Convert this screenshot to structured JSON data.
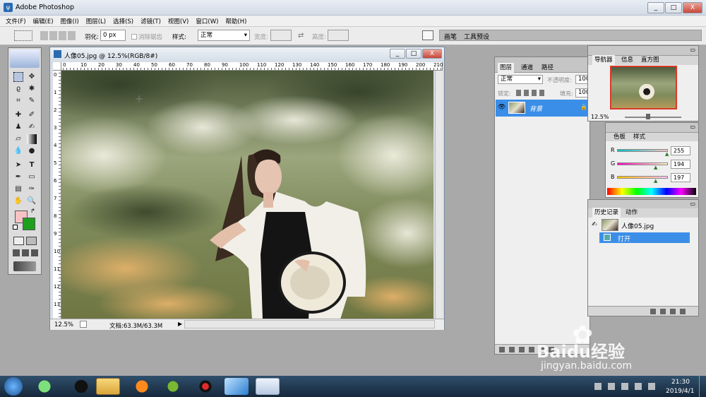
{
  "app": {
    "title": "Adobe Photoshop",
    "controls": {
      "minimize": "_",
      "maximize": "□",
      "close": "X"
    }
  },
  "menu": [
    "文件(F)",
    "编辑(E)",
    "图像(I)",
    "图层(L)",
    "选择(S)",
    "滤镜(T)",
    "视图(V)",
    "窗口(W)",
    "帮助(H)"
  ],
  "options": {
    "feather_label": "羽化:",
    "feather_value": "0 px",
    "antialias_label": "消除锯齿",
    "style_label": "样式:",
    "style_value": "正常",
    "width_label": "宽度:",
    "height_label": "高度:",
    "palette_tabs": [
      "画笔",
      "工具预设"
    ]
  },
  "document": {
    "title": "人像05.jpg @ 12.5%(RGB/8#)",
    "zoom": "12.5%",
    "doc_info": "文档:63.3M/63.3M",
    "ruler_h": [
      "0",
      "10",
      "20",
      "30",
      "40",
      "50",
      "60",
      "70",
      "80",
      "90",
      "100",
      "110",
      "120",
      "130",
      "140",
      "150",
      "160",
      "170",
      "180",
      "190",
      "200",
      "210"
    ],
    "ruler_v": [
      "0",
      "1",
      "2",
      "3",
      "4",
      "5",
      "6",
      "7",
      "8",
      "9",
      "10",
      "11",
      "12",
      "13"
    ]
  },
  "layers_panel": {
    "tabs": [
      "图层",
      "通道",
      "路径"
    ],
    "blend_mode": "正常",
    "opacity_label": "不透明度:",
    "opacity_value": "100",
    "lock_label": "锁定:",
    "fill_label": "填充:",
    "fill_value": "100",
    "layer_name": "背景"
  },
  "navigator": {
    "tabs": [
      "导航器",
      "信息",
      "直方图"
    ],
    "zoom": "12.5%"
  },
  "color_panel": {
    "tabs": [
      "色板",
      "样式"
    ],
    "channels": [
      {
        "label": "R",
        "value": "255",
        "frac": 0.98
      },
      {
        "label": "G",
        "value": "194",
        "frac": 0.76
      },
      {
        "label": "B",
        "value": "197",
        "frac": 0.77
      }
    ]
  },
  "history_panel": {
    "tabs": [
      "历史记录",
      "动作"
    ],
    "snapshot": "人像05.jpg",
    "items": [
      "打开"
    ]
  },
  "colors": {
    "foreground": "#f7c2c5",
    "background": "#1ea01e",
    "selection": "#3b8ee8"
  },
  "watermark": {
    "brand": "Baidu经验",
    "url": "jingyan.baidu.com"
  },
  "taskbar": {
    "time": "21:30",
    "date": "2019/4/1"
  }
}
